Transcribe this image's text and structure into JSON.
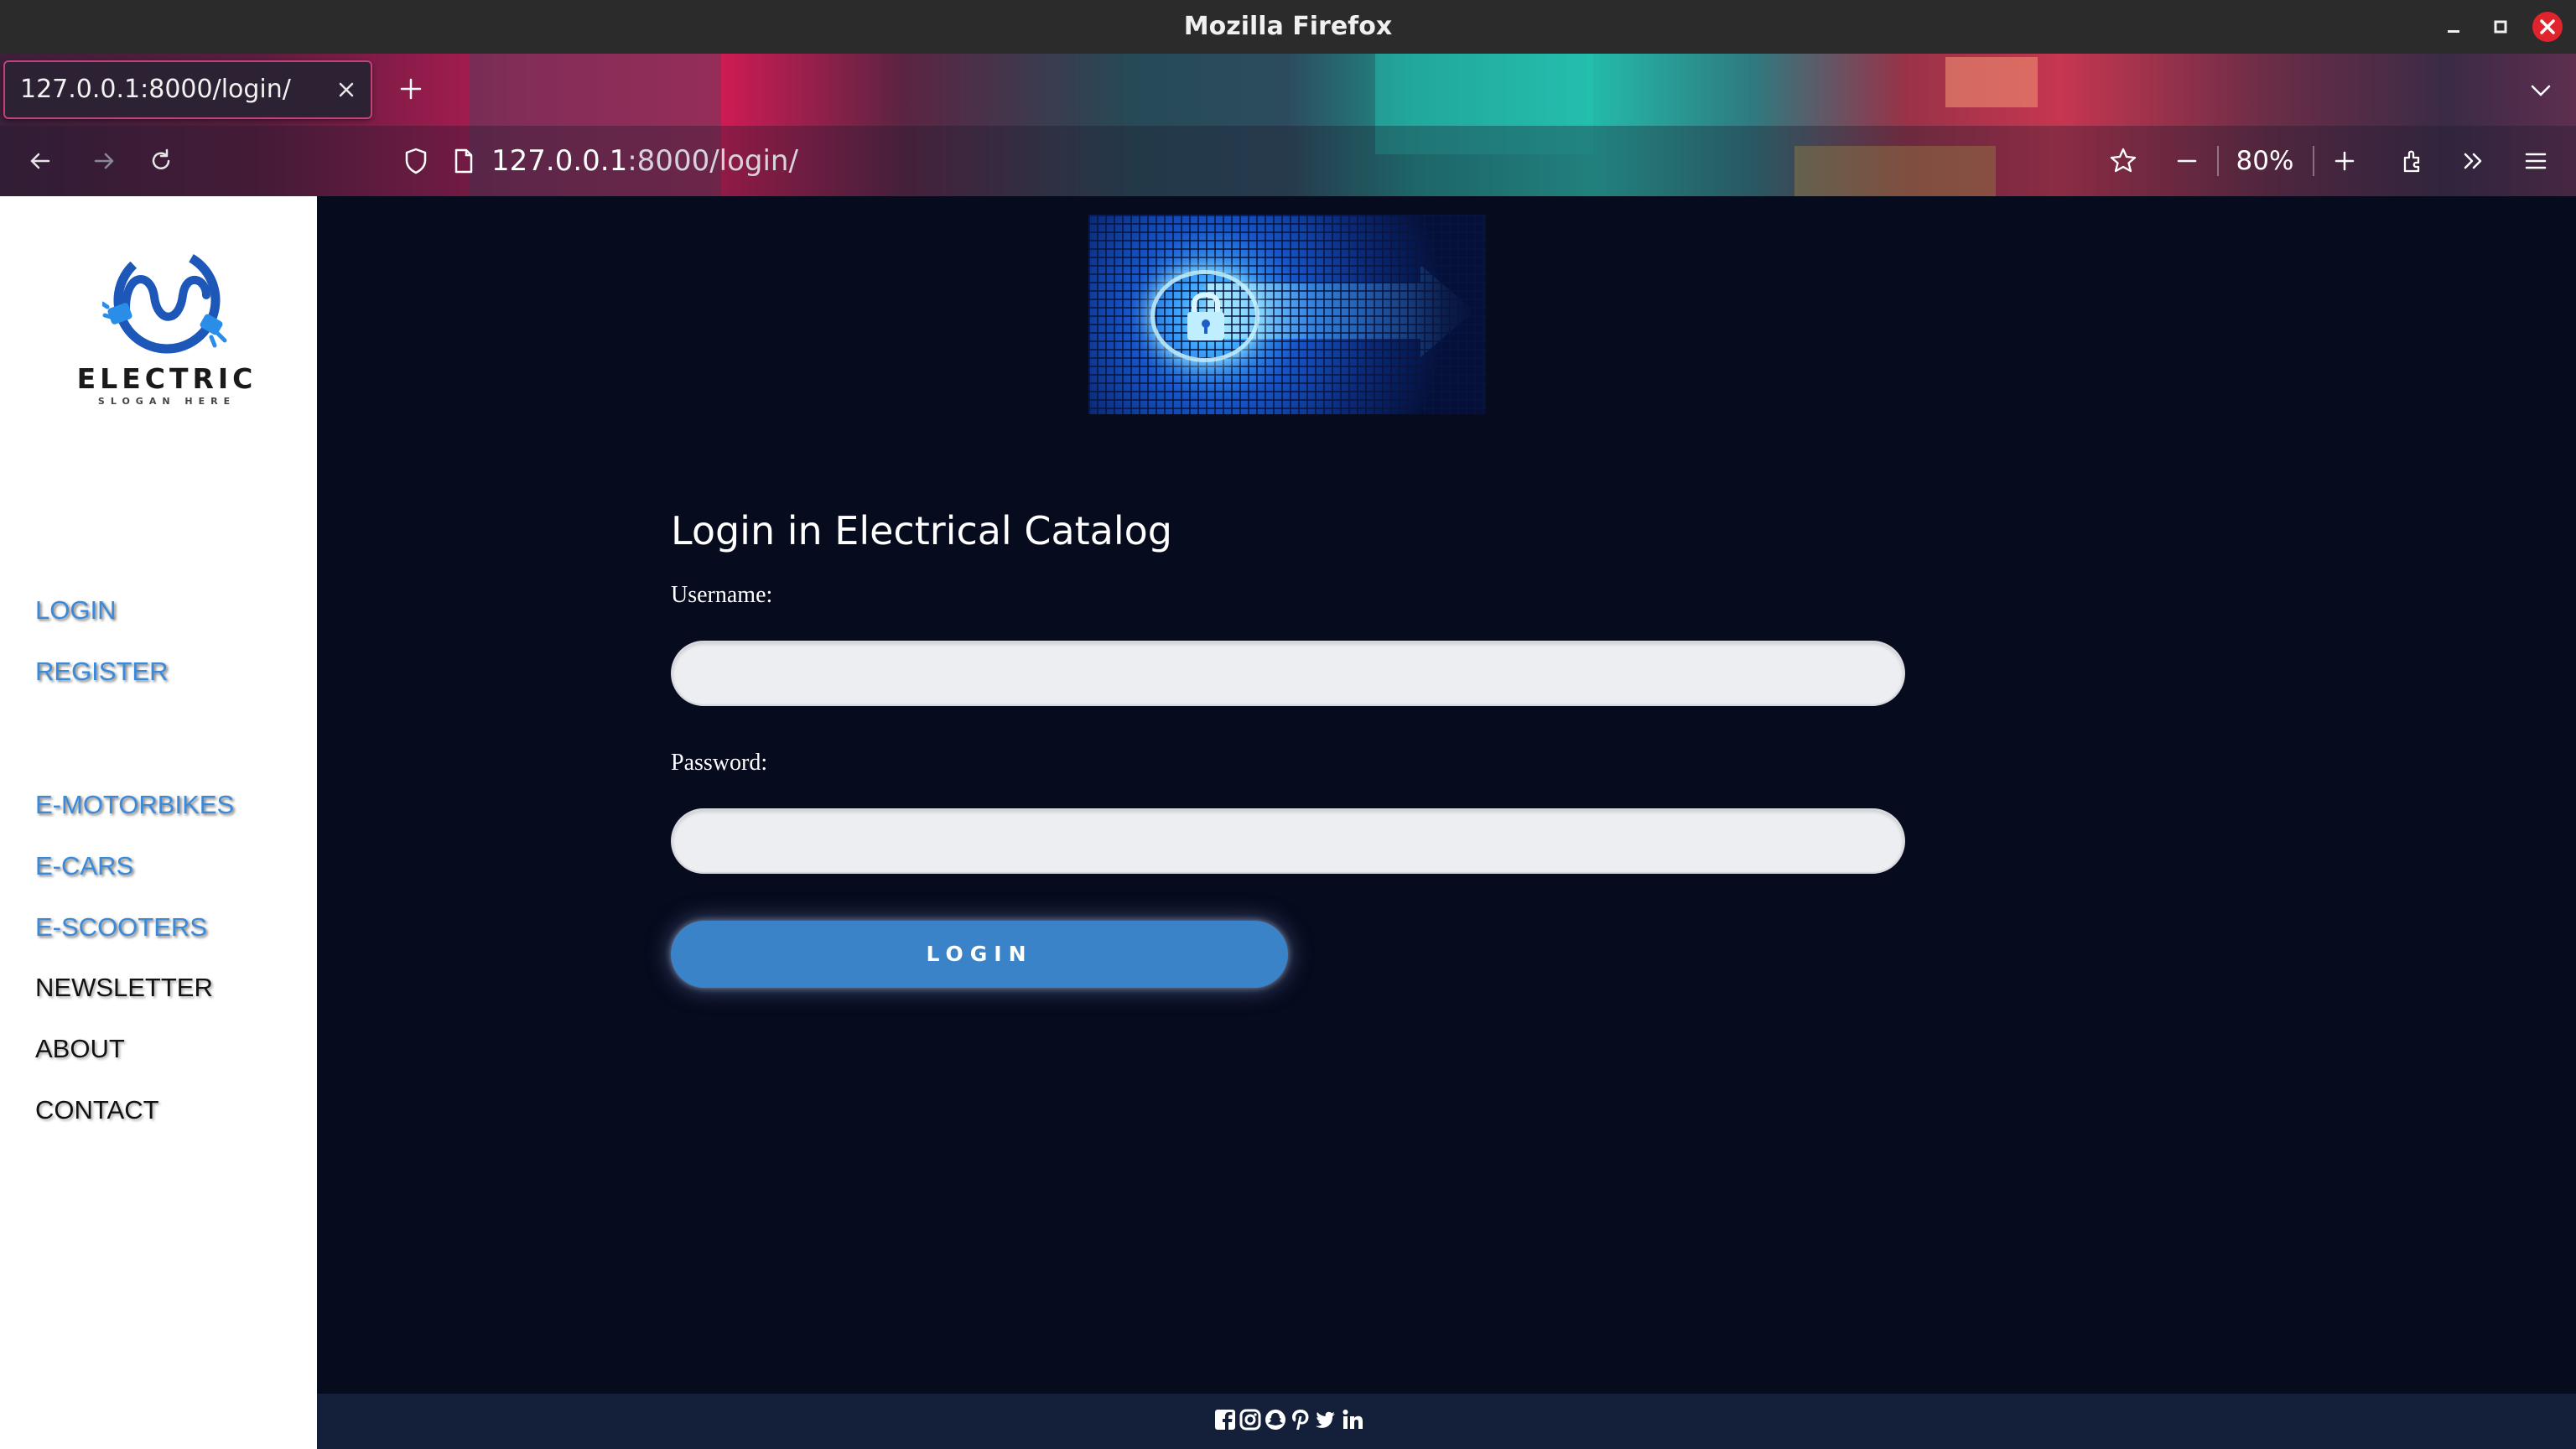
{
  "window": {
    "title": "Mozilla Firefox"
  },
  "browser": {
    "tab_title": "127.0.0.1:8000/login/",
    "url_host": "127.0.0.1",
    "url_rest": ":8000/login/",
    "zoom": "80%"
  },
  "sidebar": {
    "logo_brand": "ELECTRIC",
    "logo_slogan": "SLOGAN HERE",
    "nav_auth": [
      {
        "label": "LOGIN"
      },
      {
        "label": "REGISTER"
      }
    ],
    "nav_main": [
      {
        "label": "E-MOTORBIKES"
      },
      {
        "label": "E-CARS"
      },
      {
        "label": "E-SCOOTERS"
      },
      {
        "label": "NEWSLETTER"
      },
      {
        "label": "ABOUT"
      },
      {
        "label": "CONTACT"
      }
    ]
  },
  "login": {
    "title": "Login in Electrical Catalog",
    "username_label": "Username:",
    "username_value": "",
    "password_label": "Password:",
    "password_value": "",
    "submit_label": "LOGIN"
  },
  "footer": {
    "social_icons": [
      "facebook-icon",
      "instagram-icon",
      "snapchat-icon",
      "pinterest-icon",
      "twitter-icon",
      "linkedin-icon"
    ]
  },
  "colors": {
    "page_background": "#070b1e",
    "accent_blue": "#3a83c8",
    "nav_blue": "#3b8ad9",
    "footer_background": "#14203a"
  }
}
